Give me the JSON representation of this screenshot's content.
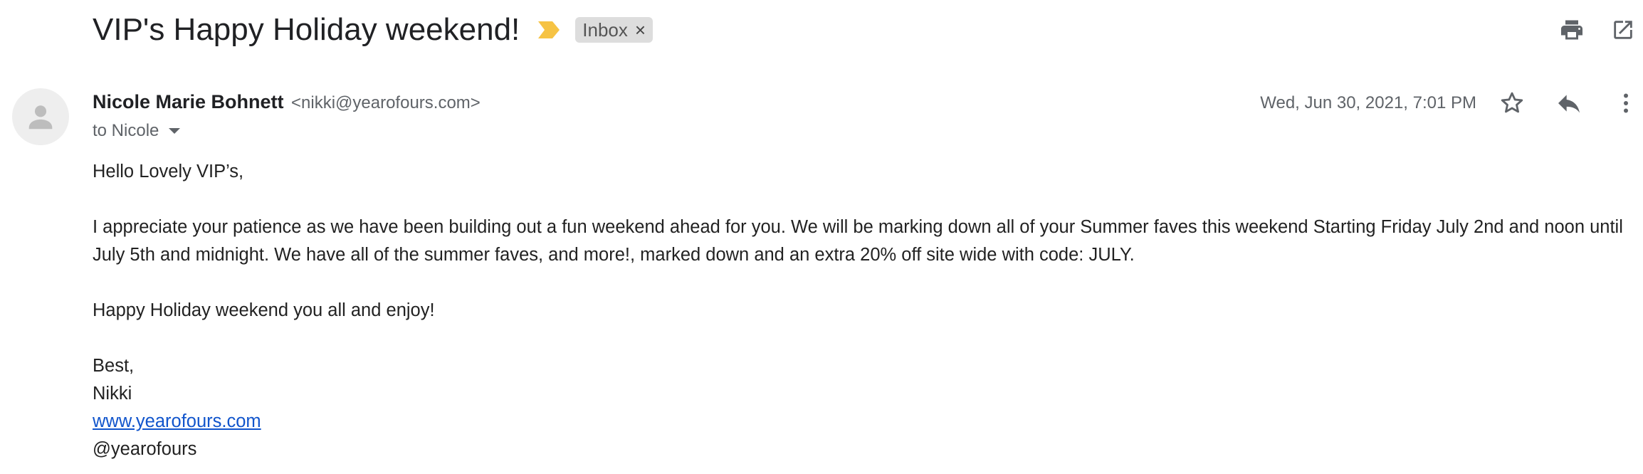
{
  "header": {
    "subject": "VIP's Happy Holiday weekend!",
    "label": "Inbox",
    "label_remove": "×",
    "importance_color": "#f6c344"
  },
  "toolbar": {
    "print_icon": "print-icon",
    "open_new_window_icon": "open-in-new-window-icon"
  },
  "message": {
    "sender_name": "Nicole Marie Bohnett",
    "sender_email": "<nikki@yearofours.com>",
    "to": "to Nicole",
    "date": "Wed, Jun 30, 2021, 7:01 PM",
    "actions": [
      "star-icon",
      "reply-icon",
      "more-vert-icon"
    ]
  },
  "body": {
    "greeting": "Hello Lovely VIP’s,",
    "paragraph1": "I appreciate your patience as we have been building out a fun weekend ahead for you. We will be marking down all of your Summer faves this weekend Starting Friday July 2nd and noon until July 5th and midnight. We have all of the summer faves, and more!,  marked down and an extra 20% off site wide with code: JULY.",
    "paragraph2": "Happy Holiday weekend you all and enjoy!",
    "signoff": "Best,",
    "signature_name": "Nikki",
    "website": "www.yearofours.com",
    "handle": "@yearofours",
    "link_color": "#1155cc"
  }
}
